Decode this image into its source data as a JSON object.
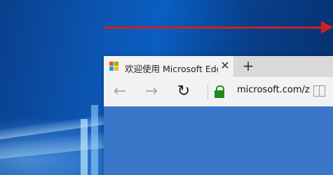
{
  "tab": {
    "title": "欢迎使用 Microsoft Edg",
    "close_glyph": "✕",
    "new_tab_glyph": "+"
  },
  "nav": {
    "back_glyph": "←",
    "forward_glyph": "→",
    "refresh_glyph": "↻",
    "address": "microsoft.com/zl"
  },
  "colors": {
    "arrow": "#d21f1f",
    "lock": "#1f8a1f",
    "content": "#3a77c8",
    "ms_red": "#f25022",
    "ms_green": "#7fba00",
    "ms_blue": "#00a4ef",
    "ms_yellow": "#ffb900"
  },
  "icons": [
    "microsoft-logo-icon",
    "close-icon",
    "plus-icon",
    "back-arrow-icon",
    "forward-arrow-icon",
    "refresh-icon",
    "lock-icon",
    "reading-view-icon"
  ]
}
